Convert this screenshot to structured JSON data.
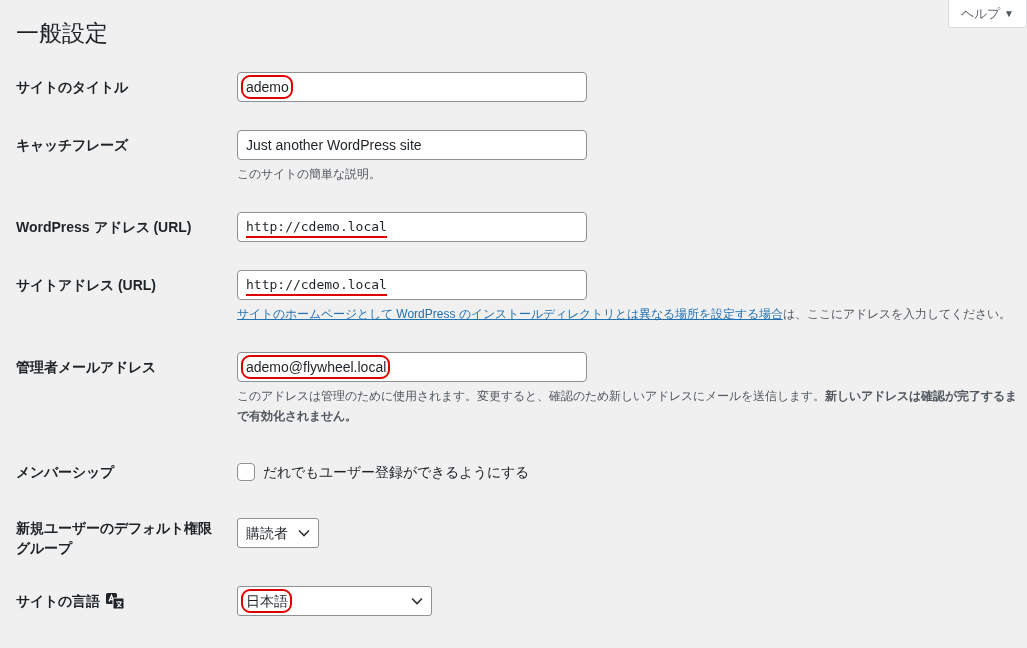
{
  "help_tab": {
    "label": "ヘルプ",
    "caret": "▼"
  },
  "heading": "一般設定",
  "rows": [
    {
      "kind": "text",
      "label": "サイトのタイトル",
      "value": "ademo",
      "circled": true
    },
    {
      "kind": "text",
      "label": "キャッチフレーズ",
      "value": "Just another WordPress site",
      "description": "このサイトの簡単な説明。"
    },
    {
      "kind": "url",
      "label": "WordPress アドレス (URL)",
      "value": "http://cdemo.local",
      "underlined": true
    },
    {
      "kind": "url",
      "label": "サイトアドレス (URL)",
      "value": "http://cdemo.local",
      "underlined": true,
      "description_link": "サイトのホームページとして WordPress のインストールディレクトリとは異なる場所を設定する場合",
      "description": "は、ここにアドレスを入力してください。"
    },
    {
      "kind": "text",
      "label": "管理者メールアドレス",
      "value": "ademo@flywheel.local",
      "circled": true,
      "description": "このアドレスは管理のために使用されます。変更すると、確認のため新しいアドレスにメールを送信します。**新しいアドレスは確認が完了するまで有効化されません。**"
    },
    {
      "kind": "checkbox",
      "label": "メンバーシップ",
      "option": "だれでもユーザー登録ができるようにする",
      "checked": false
    },
    {
      "kind": "select",
      "label": "新規ユーザーのデフォルト権限グループ",
      "value": "購読者"
    },
    {
      "kind": "wide_select",
      "label": "サイトの言語",
      "value": "日本語",
      "circled": true,
      "translate_icon": true
    }
  ]
}
